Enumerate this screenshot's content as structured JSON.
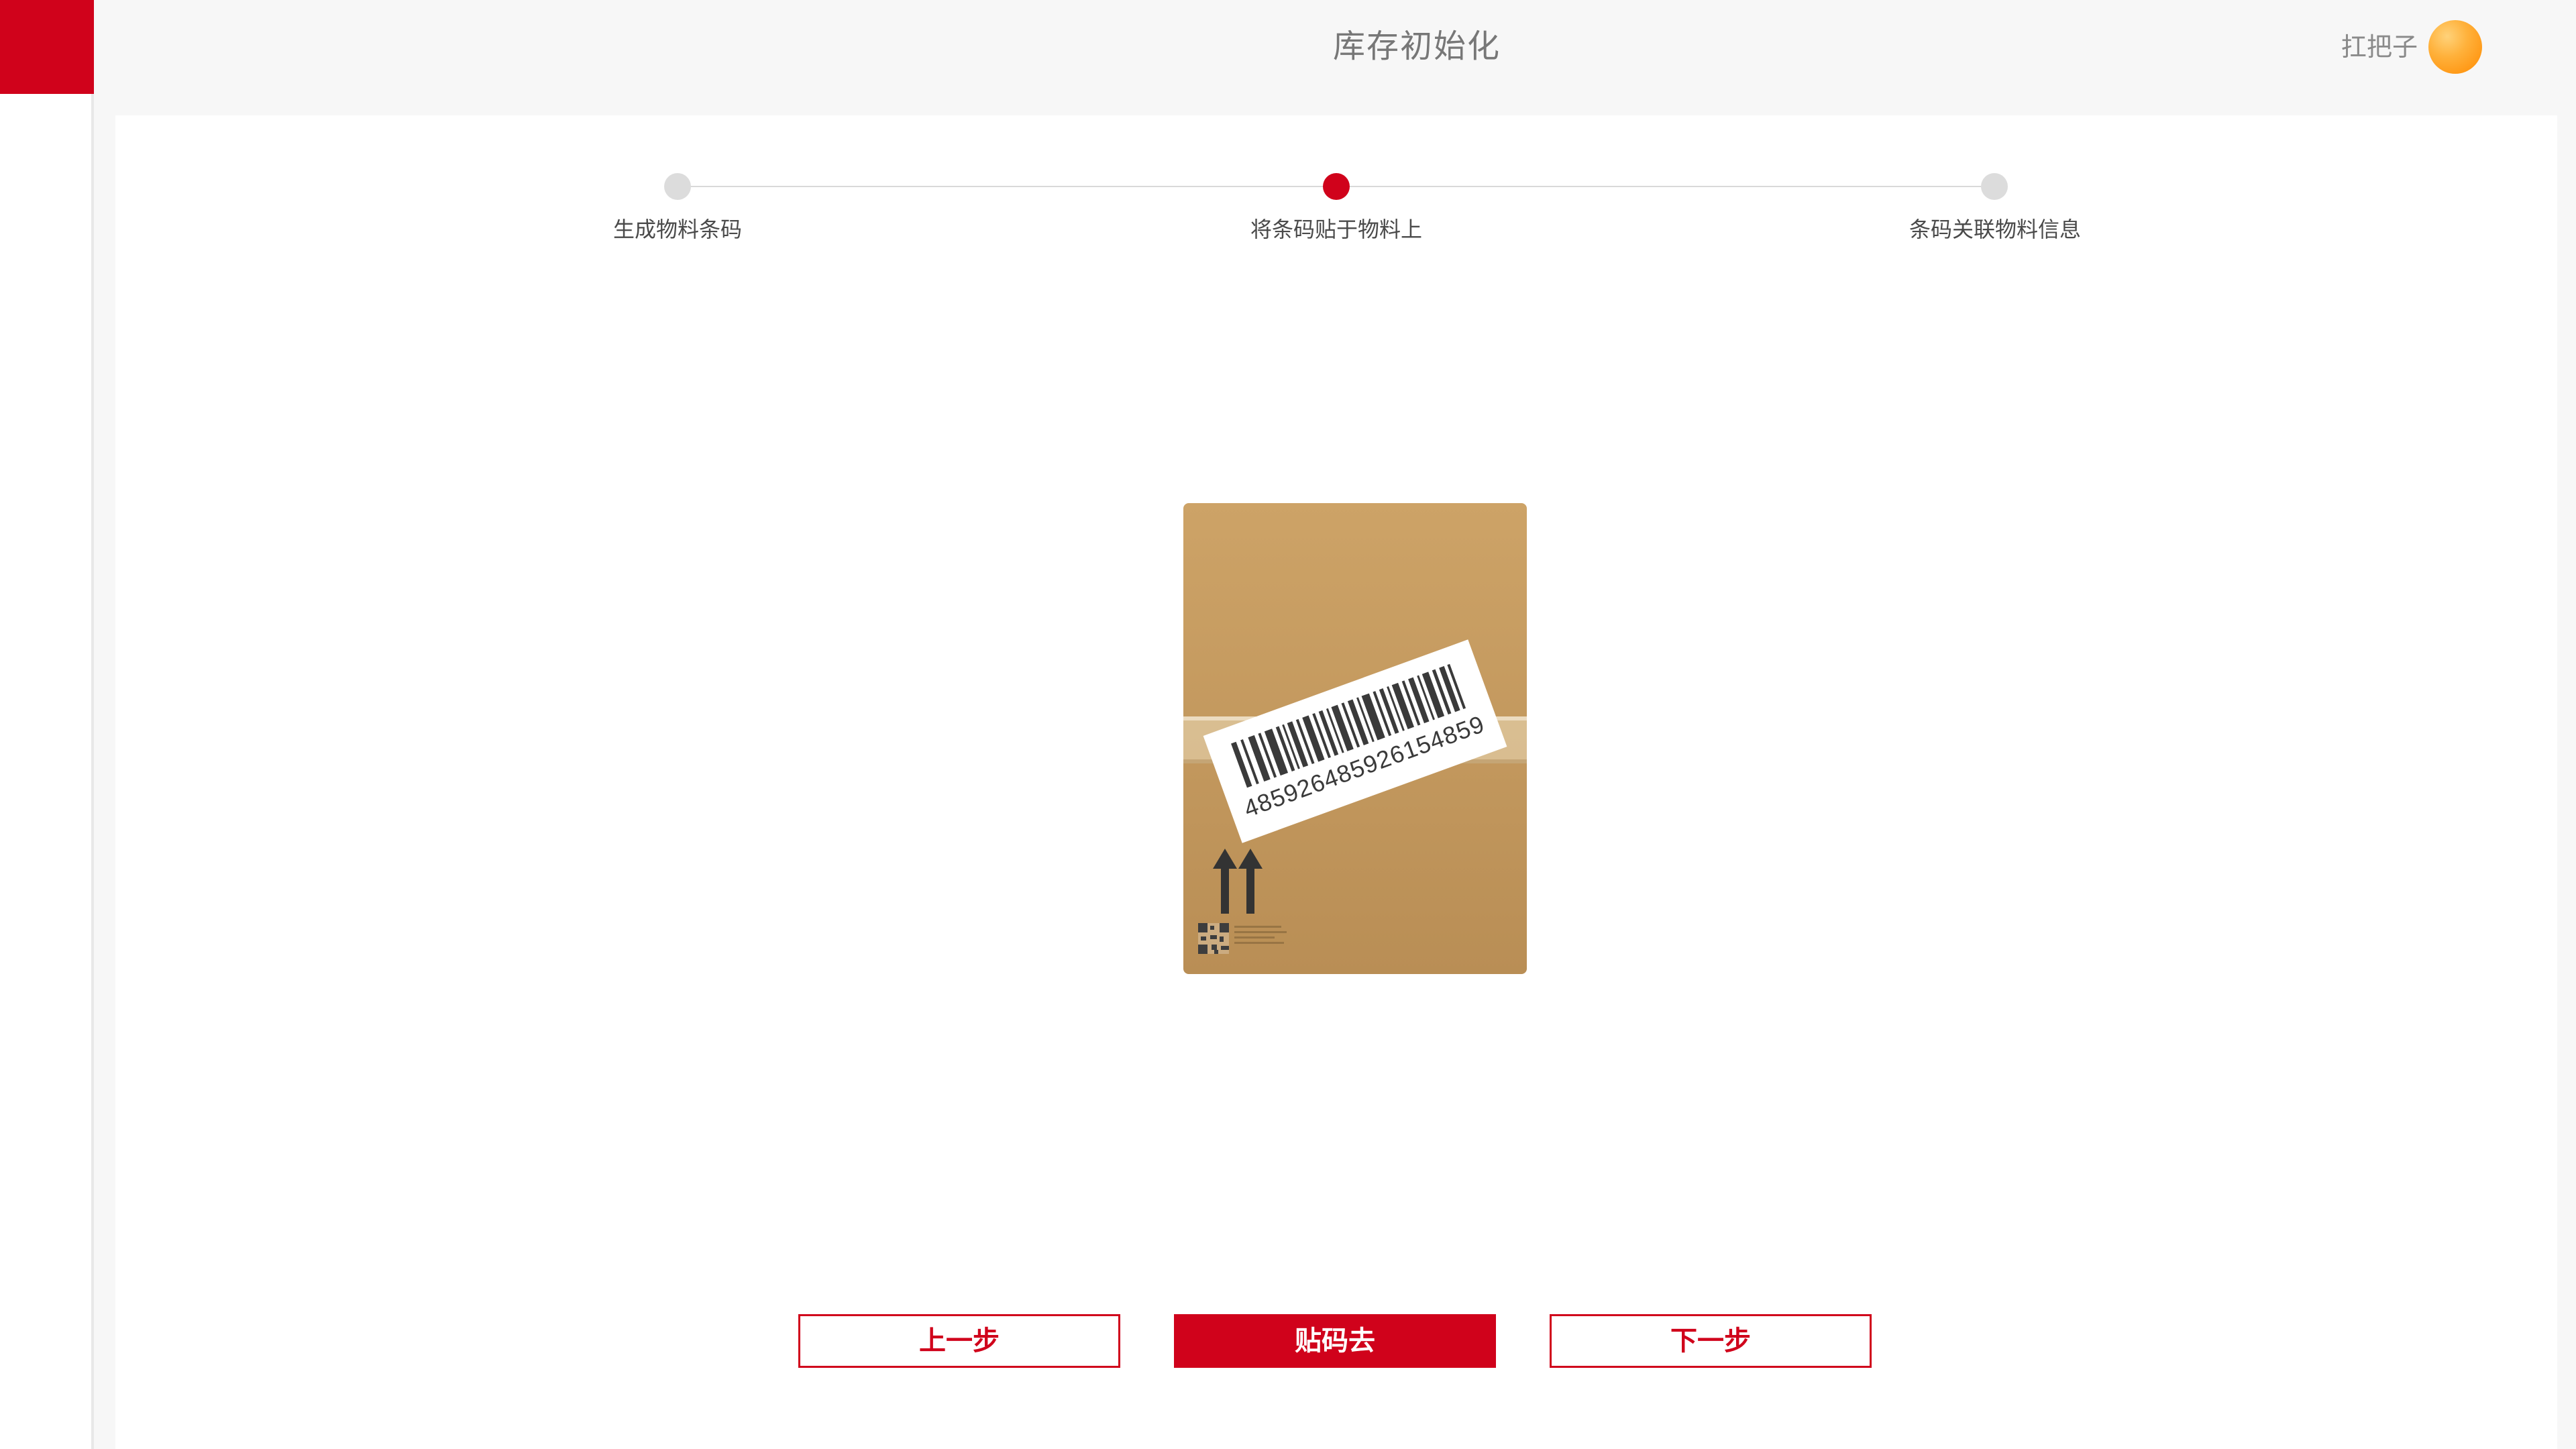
{
  "header": {
    "title": "库存初始化",
    "user_name": "扛把子"
  },
  "colors": {
    "brand": "#d0021b",
    "inactive_step": "#dcdcdc",
    "avatar": "#ff9a1a"
  },
  "stepper": {
    "current": 2,
    "steps": [
      {
        "label": "生成物料条码"
      },
      {
        "label": "将条码贴于物料上"
      },
      {
        "label": "条码关联物料信息"
      }
    ]
  },
  "illustration": {
    "barcode_number": "485926485926154859",
    "icons": [
      "cardboard-box-icon",
      "this-way-up-arrows-icon",
      "qr-code-icon"
    ]
  },
  "actions": {
    "prev_label": "上一步",
    "stick_label": "贴码去",
    "next_label": "下一步"
  }
}
